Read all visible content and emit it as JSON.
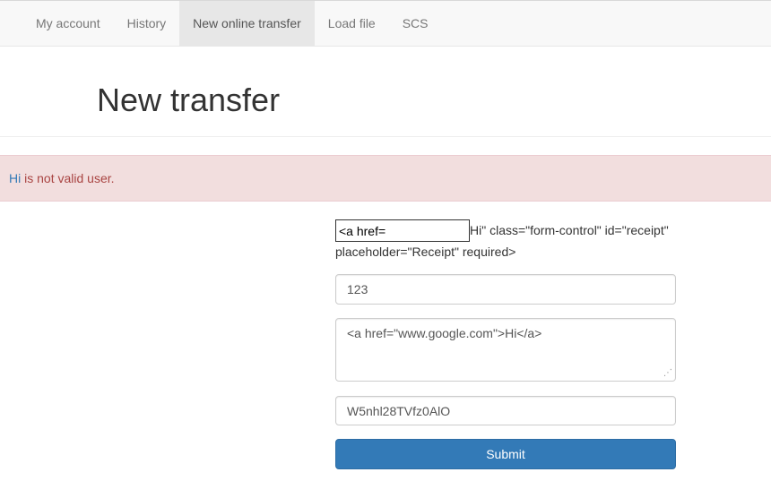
{
  "nav": {
    "items": [
      {
        "label": "My account",
        "active": false
      },
      {
        "label": "History",
        "active": false
      },
      {
        "label": "New online transfer",
        "active": true
      },
      {
        "label": "Load file",
        "active": false
      },
      {
        "label": "SCS",
        "active": false
      }
    ]
  },
  "page": {
    "title": "New transfer"
  },
  "alert": {
    "link_text": "Hi",
    "message": " is not valid user.",
    "colors": {
      "background": "#f2dede",
      "text": "#a94442",
      "link": "#337ab7"
    }
  },
  "form": {
    "receipt_input_value": "<a href=",
    "injected_text_line1": "Hi\" class=\"form-control\" id=\"receipt\"",
    "injected_text_line2": "placeholder=\"Receipt\" required>",
    "amount_value": "123",
    "message_value": "<a href=\"www.google.com\">Hi</a>",
    "code_value": "W5nhl28TVfz0AlO",
    "submit_label": "Submit",
    "submit_color": "#337ab7"
  },
  "icons": {
    "resize_grip": "resize-grip-icon"
  }
}
